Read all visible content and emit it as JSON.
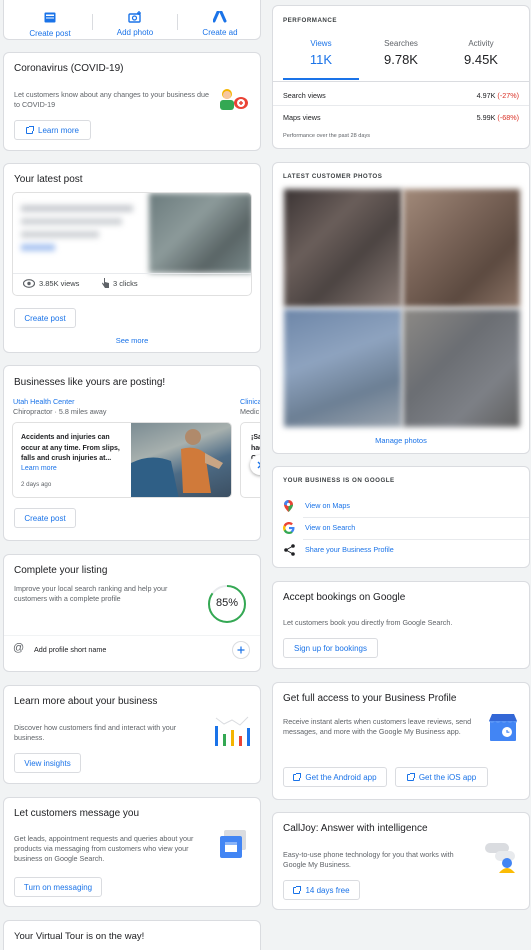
{
  "quick_actions": [
    {
      "label": "Create post",
      "icon": "post-icon"
    },
    {
      "label": "Add photo",
      "icon": "add-photo-icon"
    },
    {
      "label": "Create ad",
      "icon": "google-ads-icon"
    }
  ],
  "covid": {
    "title": "Coronavirus (COVID-19)",
    "desc": "Let customers know about any changes to your business due to COVID-19",
    "button": "Learn more"
  },
  "latest_post": {
    "title": "Your latest post",
    "views": "3.85K views",
    "clicks": "3 clicks",
    "button": "Create post",
    "see_more": "See more"
  },
  "peers": {
    "title": "Businesses like yours are posting!",
    "items": [
      {
        "name": "Utah Health Center",
        "meta": "Chiropractor · 5.8 miles away",
        "text": "Accidents and injuries can occur at any time. From slips, falls and crush injuries at...",
        "link": "Learn more",
        "date": "2 days ago"
      },
      {
        "name": "Clinica",
        "meta": "Medic",
        "text": "¡Sal hac Co"
      }
    ],
    "button": "Create post"
  },
  "listing": {
    "title": "Complete your listing",
    "desc": "Improve your local search ranking and help your customers with a complete profile",
    "percent": 85,
    "percent_label": "85%",
    "task": "Add profile short name"
  },
  "insights": {
    "title": "Learn more about your business",
    "desc": "Discover how customers find and interact with your business.",
    "button": "View insights"
  },
  "messaging": {
    "title": "Let customers message you",
    "desc": "Get leads, appointment requests and queries about your products via messaging from customers who view your business on Google Search.",
    "button": "Turn on messaging"
  },
  "virtual_tour": {
    "title": "Your Virtual Tour is on the way!"
  },
  "performance": {
    "heading": "PERFORMANCE",
    "tabs": [
      {
        "label": "Views",
        "value": "11K"
      },
      {
        "label": "Searches",
        "value": "9.78K"
      },
      {
        "label": "Activity",
        "value": "9.45K"
      }
    ],
    "rows": [
      {
        "label": "Search views",
        "value": "4.97K",
        "change": "(-27%)"
      },
      {
        "label": "Maps views",
        "value": "5.99K",
        "change": "(-68%)"
      }
    ],
    "footnote": "Performance over the past 28 days"
  },
  "photos": {
    "heading": "LATEST CUSTOMER PHOTOS",
    "link": "Manage photos"
  },
  "on_google": {
    "heading": "YOUR BUSINESS IS ON GOOGLE",
    "items": [
      {
        "label": "View on Maps",
        "icon": "maps-pin-icon"
      },
      {
        "label": "View on Search",
        "icon": "google-g-icon"
      },
      {
        "label": "Share your Business Profile",
        "icon": "share-icon"
      }
    ]
  },
  "bookings": {
    "title": "Accept bookings on Google",
    "desc": "Let customers book you directly from Google Search.",
    "button": "Sign up for bookings"
  },
  "full_access": {
    "title": "Get full access to your Business Profile",
    "desc": "Receive instant alerts when customers leave reviews, send messages, and more with the Google My Business app.",
    "android": "Get the Android app",
    "ios": "Get the iOS app"
  },
  "calljoy": {
    "title": "CallJoy: Answer with intelligence",
    "desc": "Easy-to-use phone technology for you that works with Google My Business.",
    "button": "14 days free"
  },
  "colors": {
    "accent": "#1a73e8",
    "negative": "#d93025",
    "page_bg": "#f1f3f4"
  }
}
